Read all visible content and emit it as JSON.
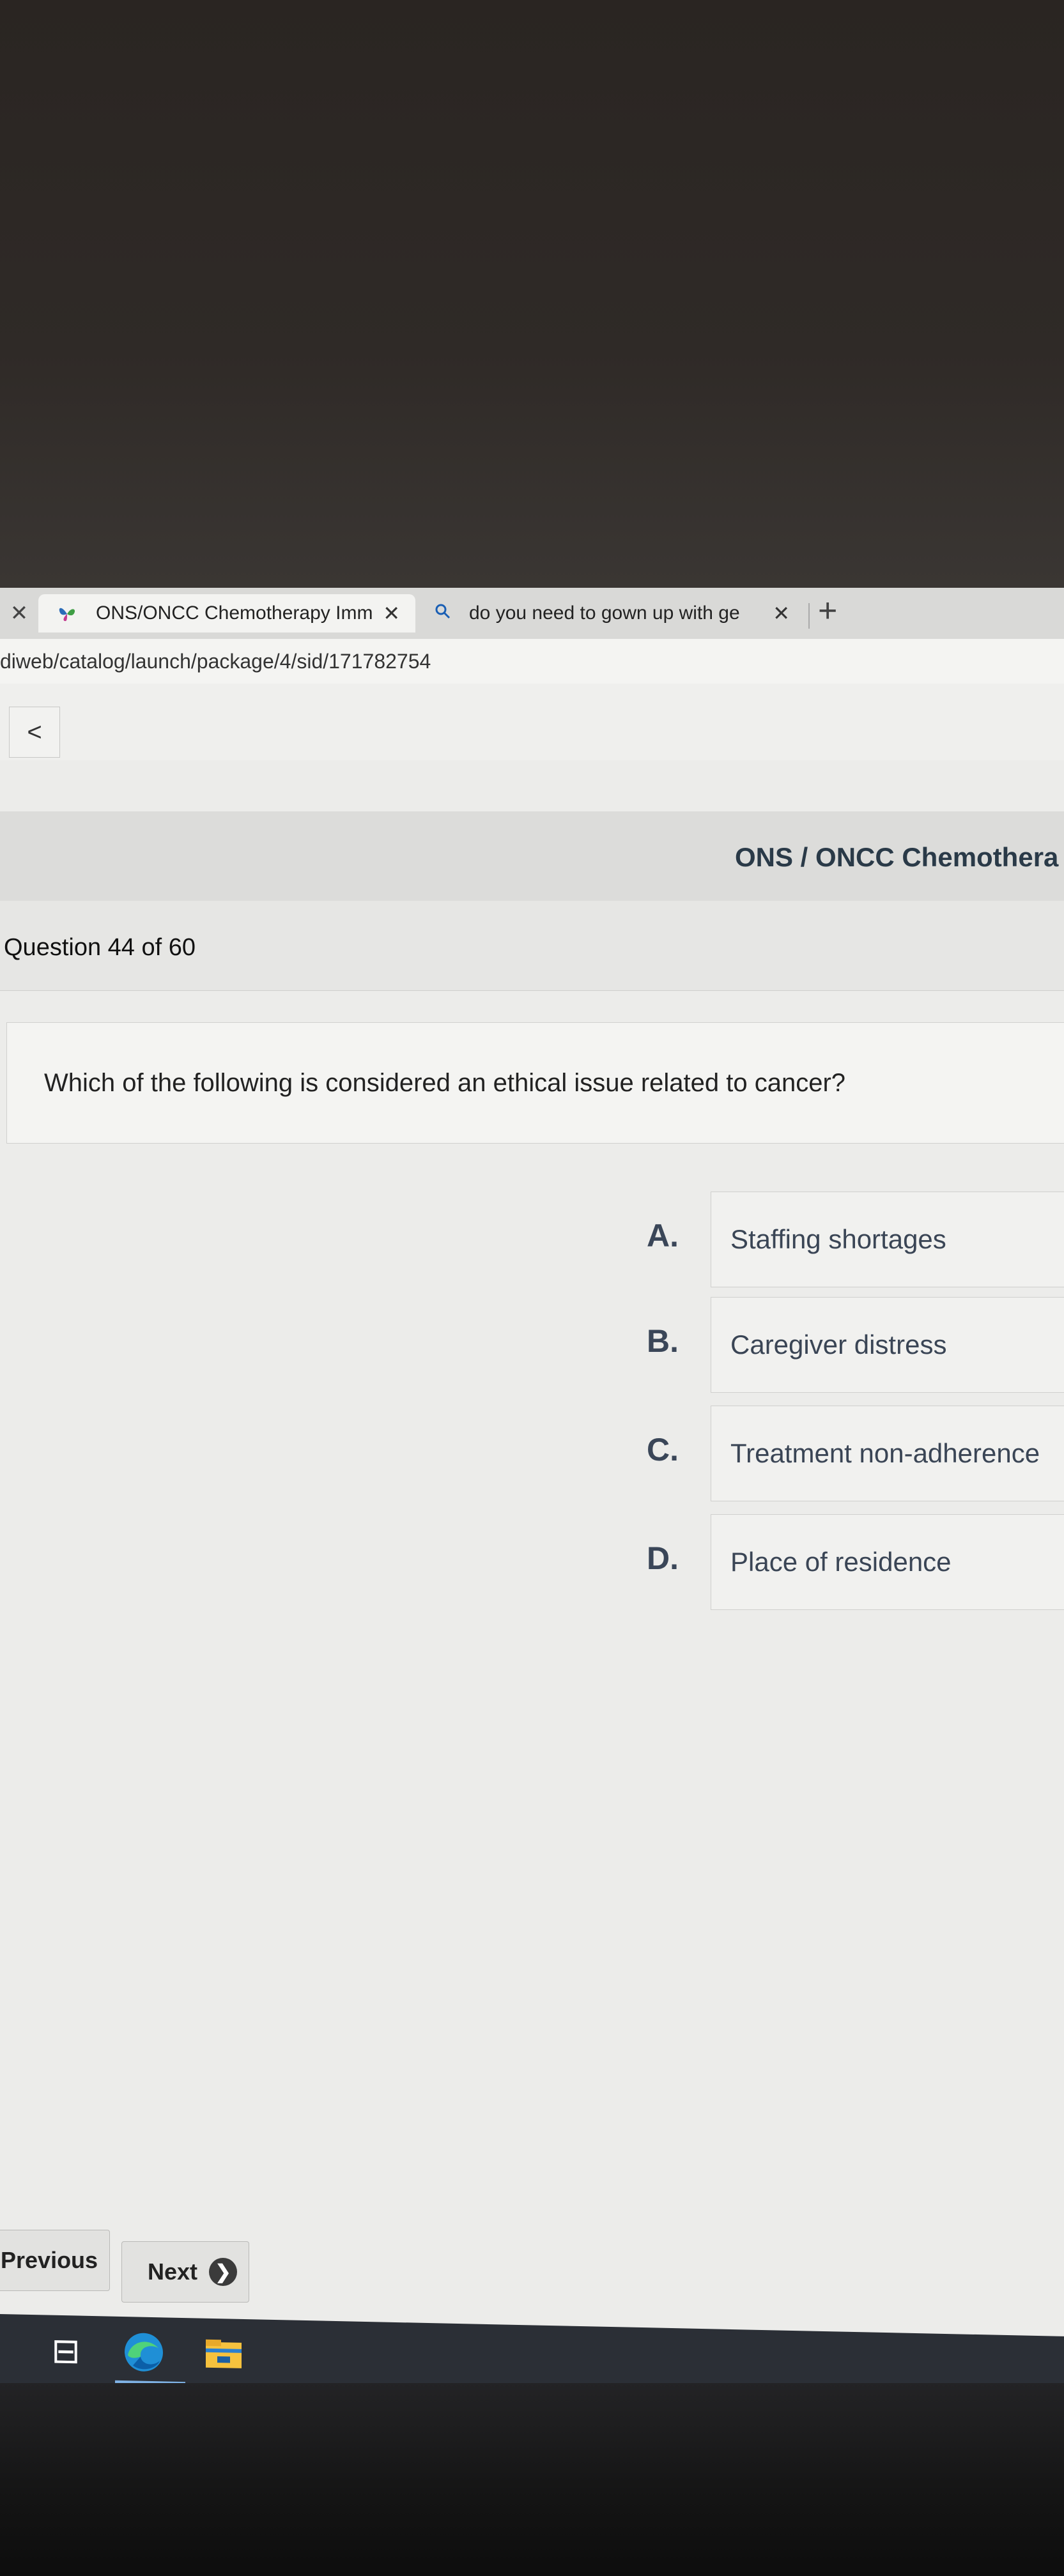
{
  "browser": {
    "tabs": [
      {
        "label": "ONS/ONCC Chemotherapy Imm",
        "close": "✕",
        "icon": "butterfly-favicon"
      },
      {
        "label": "do you need to gown up with ge",
        "close": "✕",
        "icon": "search-icon"
      }
    ],
    "close_left": "✕",
    "new_tab": "+",
    "address": "diweb/catalog/launch/package/4/sid/171782754"
  },
  "nav": {
    "back": "<"
  },
  "header": {
    "title": "ONS / ONCC Chemothera"
  },
  "quiz": {
    "progress": "Question 44 of 60",
    "question": "Which of the following is considered an ethical issue related to cancer?",
    "answers": [
      {
        "letter": "A.",
        "text": "Staffing shortages"
      },
      {
        "letter": "B.",
        "text": "Caregiver distress"
      },
      {
        "letter": "C.",
        "text": "Treatment non-adherence"
      },
      {
        "letter": "D.",
        "text": "Place of residence"
      }
    ]
  },
  "footer": {
    "previous": "Previous",
    "next": "Next",
    "next_arrow": "❯"
  },
  "taskbar": {
    "taskview_glyph": "⊟"
  }
}
